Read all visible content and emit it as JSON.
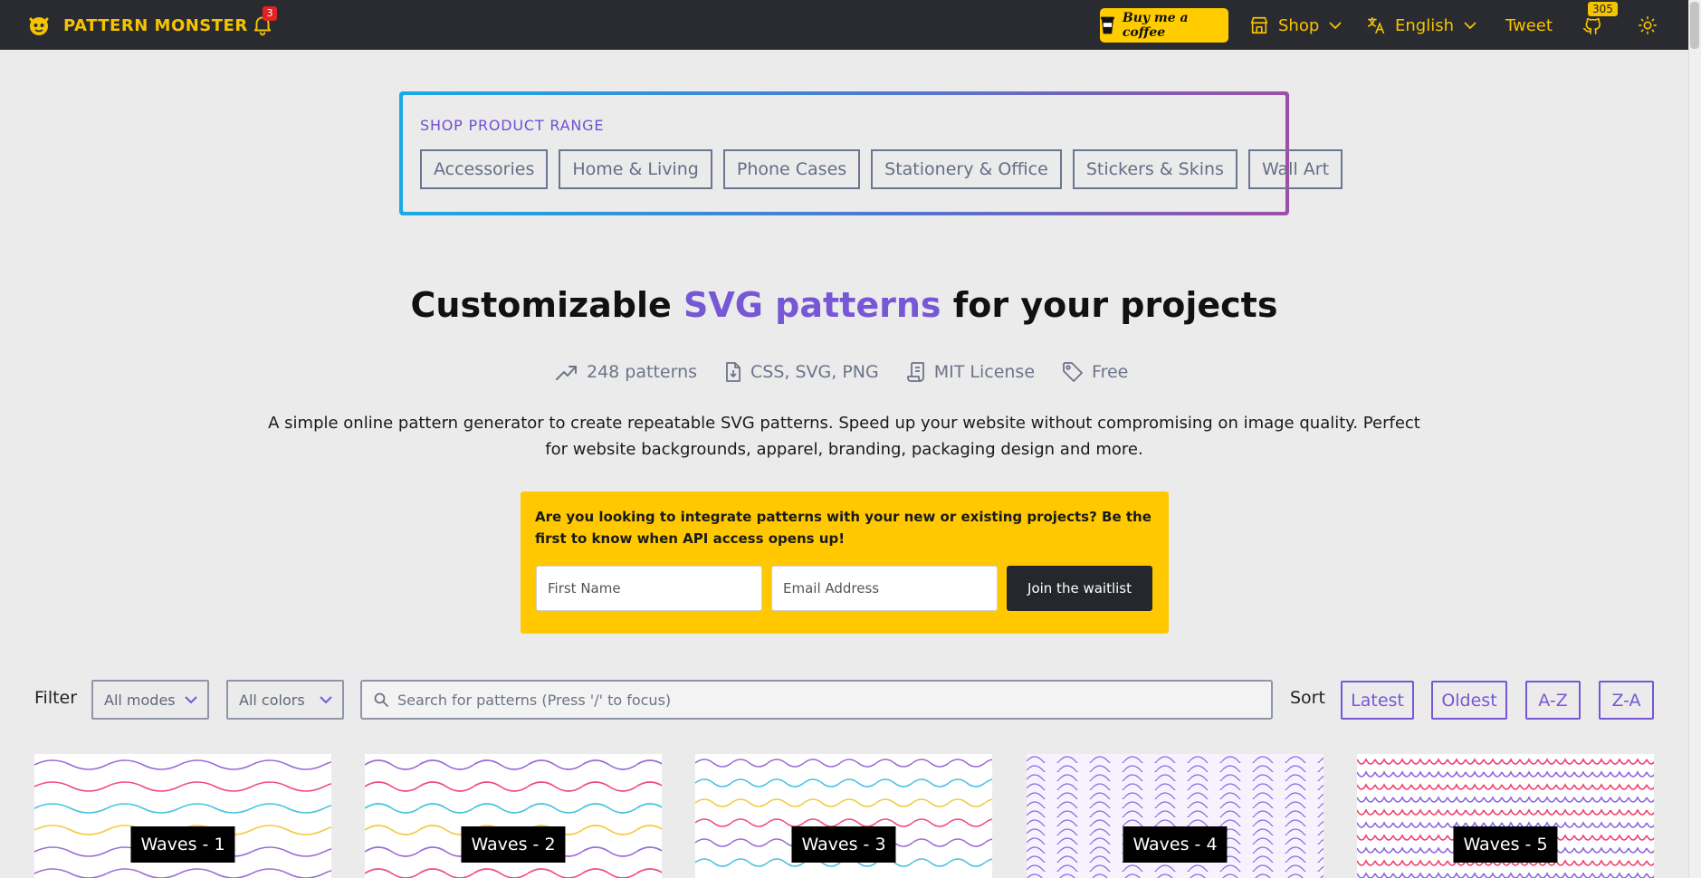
{
  "nav": {
    "brand": "PATTERN MONSTER",
    "notifications_count": "3",
    "coffee_label": "Buy me a coffee",
    "shop_label": "Shop",
    "language_label": "English",
    "tweet_label": "Tweet",
    "github_stars": "305",
    "icons": [
      "monster-logo-icon",
      "bell-icon",
      "coffee-cup-icon",
      "store-icon",
      "translate-icon",
      "github-icon",
      "sun-icon",
      "chevron-down-icon"
    ]
  },
  "shop": {
    "title": "SHOP PRODUCT RANGE",
    "tags": [
      "Accessories",
      "Home & Living",
      "Phone Cases",
      "Stationery & Office",
      "Stickers & Skins",
      "Wall Art"
    ]
  },
  "hero": {
    "title_before": "Customizable ",
    "title_accent": "SVG patterns",
    "title_after": " for your projects",
    "features": [
      "248 patterns",
      "CSS, SVG, PNG",
      "MIT License",
      "Free"
    ],
    "description": "A simple online pattern generator to create repeatable SVG patterns. Speed up your website without compromising on image quality. Perfect for website backgrounds, apparel, branding, packaging design and more."
  },
  "waitlist": {
    "text": "Are you looking to integrate patterns with your new or existing projects? Be the first to know when API access opens up!",
    "first_name_placeholder": "First Name",
    "email_placeholder": "Email Address",
    "button_label": "Join the waitlist"
  },
  "filters": {
    "filter_label": "Filter",
    "modes_value": "All modes",
    "colors_value": "All colors",
    "search_placeholder": "Search for patterns (Press '/' to focus)",
    "sort_label": "Sort",
    "sort_options": [
      "Latest",
      "Oldest",
      "A-Z",
      "Z-A"
    ]
  },
  "cards": [
    {
      "label": "Waves - 1"
    },
    {
      "label": "Waves - 2"
    },
    {
      "label": "Waves - 3"
    },
    {
      "label": "Waves - 4"
    },
    {
      "label": "Waves - 5"
    }
  ],
  "colors": {
    "accent": "#7757d6",
    "brand_yellow": "#f5c400",
    "nav_bg": "#2a2b30",
    "waitlist_bg": "#ffc800"
  }
}
